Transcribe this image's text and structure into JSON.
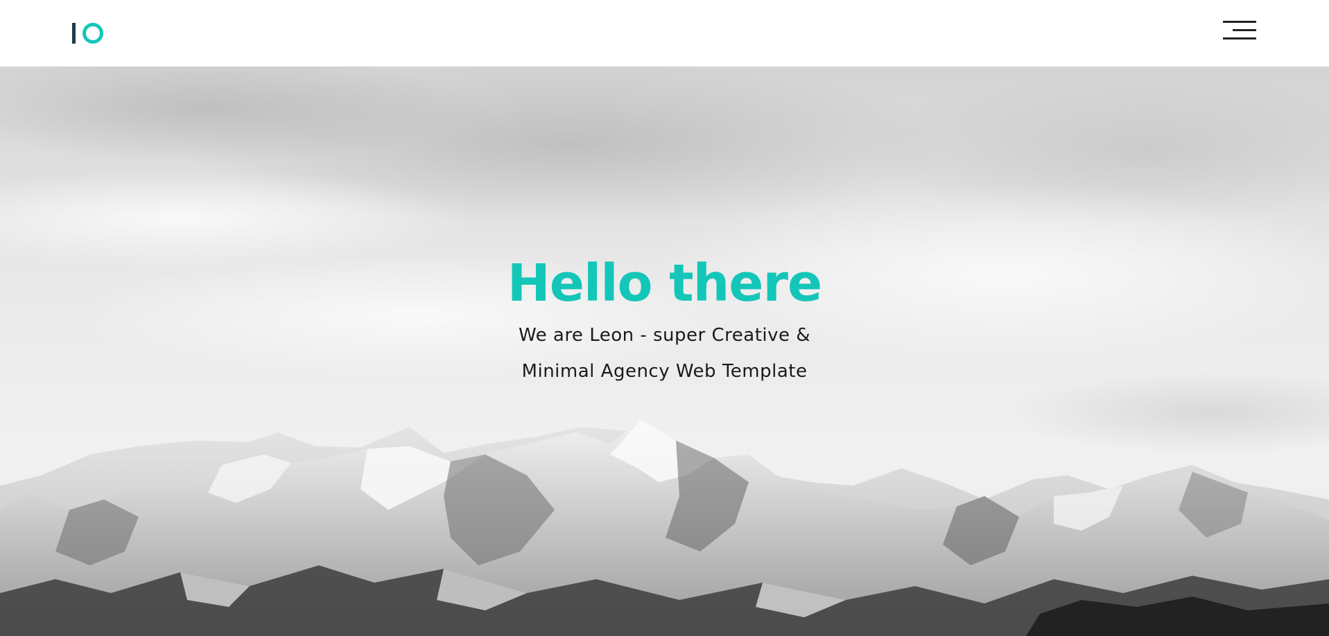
{
  "header": {
    "logo_name": "logo",
    "menu_icon": "hamburger-menu-icon"
  },
  "hero": {
    "title": "Hello there",
    "subtitle_line1": "We are Leon - super Creative &",
    "subtitle_line2": "Minimal Agency Web Template"
  },
  "colors": {
    "accent": "#14c6b8",
    "logo_dark": "#1f3d4a",
    "text": "#1a1a1a"
  }
}
